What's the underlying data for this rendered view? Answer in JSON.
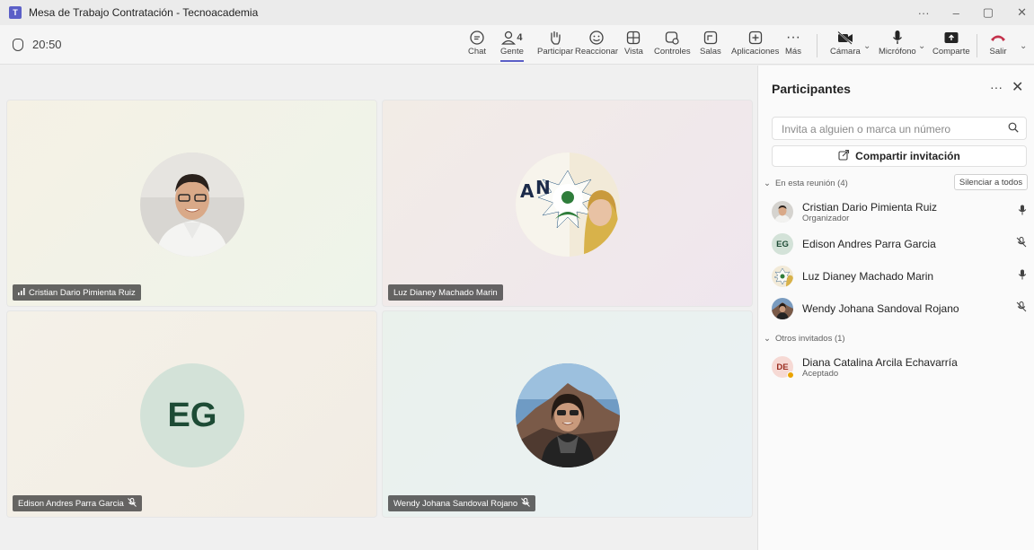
{
  "window": {
    "title": "Mesa de Trabajo Contratación - Tecnoacademia",
    "controls": [
      "···",
      "–",
      "▢",
      "✕"
    ]
  },
  "toolbar": {
    "timer": "20:50",
    "people_count": "4",
    "buttons": {
      "chat": "Chat",
      "people": "Gente",
      "raise": "Participar",
      "react": "Reaccionar",
      "view": "Vista",
      "controls": "Controles",
      "rooms": "Salas",
      "apps": "Aplicaciones",
      "more": "Más",
      "camera": "Cámara",
      "mic": "Micrófono",
      "share": "Comparte",
      "leave": "Salir"
    },
    "accent": "#5b5fc7",
    "leave_color": "#c4314b"
  },
  "tiles": [
    {
      "name": "Cristian Dario Pimienta Ruiz",
      "muted": false
    },
    {
      "name": "Luz Dianey Machado Marin",
      "muted": false
    },
    {
      "name": "Edison Andres Parra Garcia",
      "muted": true,
      "initials": "EG"
    },
    {
      "name": "Wendy Johana Sandoval Rojano",
      "muted": true
    }
  ],
  "panel": {
    "title": "Participantes",
    "search_placeholder": "Invita a alguien o marca un número",
    "share_label": "Compartir invitación",
    "in_meeting_label": "En esta reunión (4)",
    "mute_all_label": "Silenciar a todos",
    "others_label": "Otros invitados (1)",
    "participants": [
      {
        "name": "Cristian Dario Pimienta Ruiz",
        "role": "Organizador",
        "mic": "on"
      },
      {
        "name": "Edison Andres Parra Garcia",
        "initials": "EG",
        "mic": "off"
      },
      {
        "name": "Luz Dianey Machado Marin",
        "mic": "on"
      },
      {
        "name": "Wendy Johana Sandoval Rojano",
        "mic": "off"
      }
    ],
    "invited": [
      {
        "name": "Diana Catalina Arcila Echavarría",
        "initials": "DE",
        "role": "Aceptado"
      }
    ]
  }
}
